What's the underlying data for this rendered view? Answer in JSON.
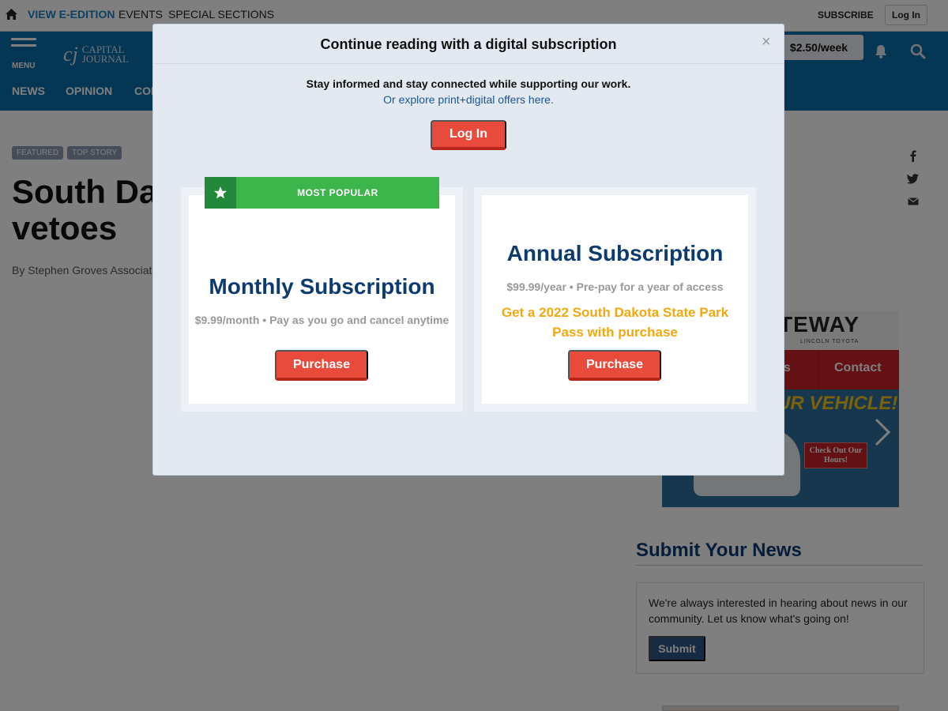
{
  "topbar": {
    "links": [
      "VIEW E-EDITION",
      "EVENTS",
      "SPECIAL SECTIONS"
    ],
    "subscribe": "SUBSCRIBE",
    "login": "Log In"
  },
  "masthead": {
    "menu_label": "MENU",
    "logo_mark": "cj",
    "logo_line1": "CAPITAL",
    "logo_line2": "JOURNAL",
    "price_pill": "$2.50/week",
    "nav": [
      "NEWS",
      "OPINION",
      "CON"
    ]
  },
  "article": {
    "tags": [
      "FEATURED",
      "TOP STORY"
    ],
    "headline_line1": "South Dal",
    "headline_line2": "vetoes",
    "byline": "By Stephen Groves Associate"
  },
  "ad": {
    "brand": "TEWAY",
    "sub": "LINCOLN  TOYOTA",
    "menu_1": "ils",
    "menu_2": "Contact",
    "tagline": "UR VEHICLE!",
    "cta": "Check Out Our Hours!"
  },
  "submit_news": {
    "title": "Submit Your News",
    "text": "We're always interested in hearing about news in our community. Let us know what's going on!",
    "button": "Submit"
  },
  "modal": {
    "title": "Continue reading with a digital subscription",
    "close": "×",
    "intro": "Stay informed and stay connected while supporting our work.",
    "link": "Or explore print+digital offers here.",
    "login": "Log In",
    "ribbon": "MOST POPULAR",
    "monthly": {
      "name": "Monthly Subscription",
      "price": "$9.99/month • Pay as you go and cancel anytime",
      "button": "Purchase"
    },
    "annual": {
      "name": "Annual Subscription",
      "price": "$99.99/year • Pre-pay for a year of access",
      "promo": "Get a 2022 South Dakota State Park Pass with purchase",
      "button": "Purchase"
    }
  },
  "colors": {
    "masthead_blue": "#0b6ea9",
    "accent_red": "#e84a3b",
    "ribbon_green": "#3cb54a",
    "promo_gold": "#f2a911",
    "plan_navy": "#0d3b70"
  }
}
